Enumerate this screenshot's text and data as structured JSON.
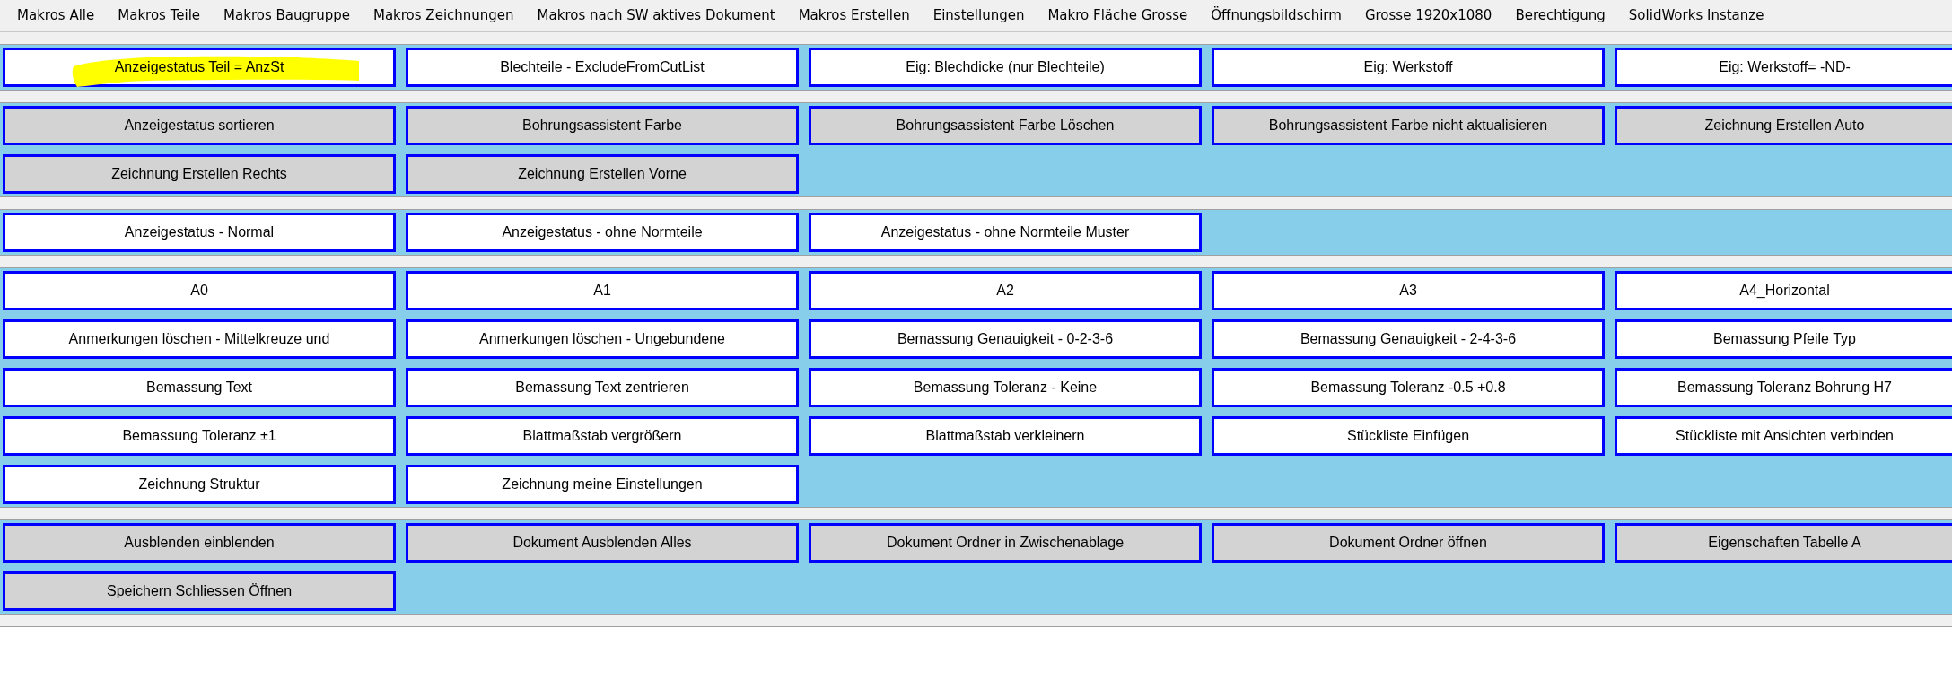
{
  "menu": [
    {
      "label": "Makros Alle"
    },
    {
      "label": "Makros Teile"
    },
    {
      "label": "Makros Baugruppe"
    },
    {
      "label": "Makros Zeichnungen"
    },
    {
      "label": "Makros nach SW aktives Dokument"
    },
    {
      "label": "Makros Erstellen"
    },
    {
      "label": "Einstellungen"
    },
    {
      "label": "Makro Fläche Grosse"
    },
    {
      "label": "Öffnungsbildschirm"
    },
    {
      "label": "Grosse 1920x1080"
    },
    {
      "label": "Berechtigung"
    },
    {
      "label": "SolidWorks Instanze"
    }
  ],
  "sections": [
    {
      "kind": "white",
      "buttons": [
        {
          "label": "Anzeigestatus Teil = AnzSt",
          "highlighted": true
        },
        {
          "label": "Blechteile - ExcludeFromCutList",
          "highlighted": false
        },
        {
          "label": "Eig: Blechdicke (nur Blechteile)",
          "highlighted": false
        },
        {
          "label": "Eig: Werkstoff",
          "highlighted": false
        },
        {
          "label": "Eig: Werkstoff= -ND-",
          "highlighted": false
        }
      ]
    },
    {
      "kind": "gray",
      "buttons": [
        {
          "label": "Anzeigestatus sortieren",
          "highlighted": false
        },
        {
          "label": "Bohrungsassistent Farbe",
          "highlighted": false
        },
        {
          "label": "Bohrungsassistent Farbe Löschen",
          "highlighted": false
        },
        {
          "label": "Bohrungsassistent Farbe nicht aktualisieren",
          "highlighted": false
        },
        {
          "label": "Zeichnung Erstellen Auto",
          "highlighted": false
        },
        {
          "label": "Zeichnung Erstellen Rechts",
          "highlighted": false
        },
        {
          "label": "Zeichnung Erstellen Vorne",
          "highlighted": false
        }
      ]
    },
    {
      "kind": "white",
      "buttons": [
        {
          "label": "Anzeigestatus - Normal",
          "highlighted": false
        },
        {
          "label": "Anzeigestatus - ohne Normteile",
          "highlighted": false
        },
        {
          "label": "Anzeigestatus - ohne Normteile Muster",
          "highlighted": false
        }
      ]
    },
    {
      "kind": "white",
      "buttons": [
        {
          "label": "A0",
          "highlighted": false
        },
        {
          "label": "A1",
          "highlighted": false
        },
        {
          "label": "A2",
          "highlighted": false
        },
        {
          "label": "A3",
          "highlighted": false
        },
        {
          "label": "A4_Horizontal",
          "highlighted": false
        },
        {
          "label": "Anmerkungen löschen - Mittelkreuze und",
          "highlighted": false
        },
        {
          "label": "Anmerkungen löschen - Ungebundene",
          "highlighted": false
        },
        {
          "label": "Bemassung Genauigkeit - 0-2-3-6",
          "highlighted": false
        },
        {
          "label": "Bemassung Genauigkeit - 2-4-3-6",
          "highlighted": false
        },
        {
          "label": "Bemassung Pfeile Typ",
          "highlighted": false
        },
        {
          "label": "Bemassung Text",
          "highlighted": false
        },
        {
          "label": "Bemassung Text zentrieren",
          "highlighted": false
        },
        {
          "label": "Bemassung Toleranz - Keine",
          "highlighted": false
        },
        {
          "label": "Bemassung Toleranz -0.5 +0.8",
          "highlighted": false
        },
        {
          "label": "Bemassung Toleranz Bohrung H7",
          "highlighted": false
        },
        {
          "label": "Bemassung Toleranz ±1",
          "highlighted": false
        },
        {
          "label": "Blattmaßstab  vergrößern",
          "highlighted": false
        },
        {
          "label": "Blattmaßstab  verkleinern",
          "highlighted": false
        },
        {
          "label": "Stückliste Einfügen",
          "highlighted": false
        },
        {
          "label": "Stückliste mit Ansichten verbinden",
          "highlighted": false
        },
        {
          "label": "Zeichnung Struktur",
          "highlighted": false
        },
        {
          "label": "Zeichnung meine Einstellungen",
          "highlighted": false
        }
      ]
    },
    {
      "kind": "gray",
      "buttons": [
        {
          "label": "Ausblenden einblenden",
          "highlighted": false
        },
        {
          "label": "Dokument Ausblenden Alles",
          "highlighted": false
        },
        {
          "label": "Dokument Ordner in Zwischenablage",
          "highlighted": false
        },
        {
          "label": "Dokument Ordner öffnen",
          "highlighted": false
        },
        {
          "label": "Eigenschaften Tabelle A",
          "highlighted": false
        },
        {
          "label": "Speichern Schliessen Öffnen",
          "highlighted": false
        }
      ]
    }
  ]
}
